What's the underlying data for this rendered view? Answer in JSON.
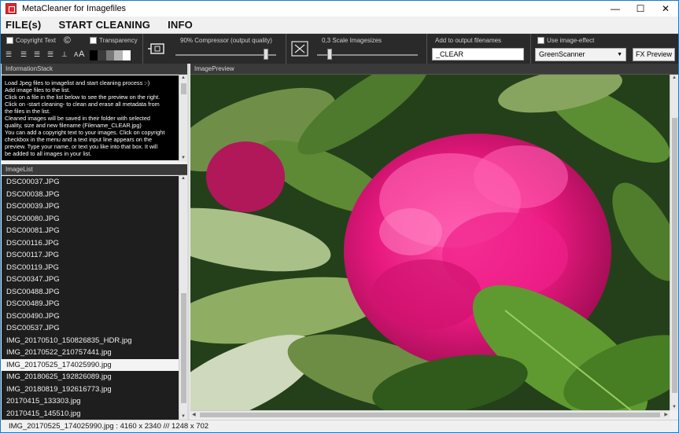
{
  "window": {
    "title": "MetaCleaner for Imagefiles",
    "controls": {
      "minimize": "—",
      "maximize": "☐",
      "close": "✕"
    }
  },
  "menu": [
    "FILE(s)",
    "START CLEANING",
    "INFO"
  ],
  "toolbar": {
    "copyright_label": "Copyright Text",
    "copyright_symbol": "©",
    "transparency_label": "Transparency",
    "compressor_label": "90% Compressor (output quality)",
    "compressor_value": 0.9,
    "scale_label": "0,3 Scale Imagesizes",
    "scale_value": 0.3,
    "filename_label": "Add to output filenames",
    "filename_value": "_CLEAR",
    "image_effect_label": "Use image-effect",
    "effect_selected": "GreenScanner",
    "fx_preview_label": "FX Preview",
    "font_size_icon": "A",
    "font_size_icon_small": "A"
  },
  "info_panel": {
    "header": "InformationStack",
    "lines": [
      "Load Jpeg files to imagelist and start cleaning process :-)",
      "Add image files to the list.",
      "Click on a file in the list below to see the preview on the right.",
      "Click on -start cleaning- to clean and erase all metadata from",
      "the files in the list.",
      "Cleaned images will be saved in their folder with selected",
      "quality, size and new filename (Filename_CLEAR.jpg)",
      "You can add a copyright text to your images. Click on copyright",
      "checkbox in the menu and a text input line appears on the",
      "preview. Type your name, or text you like into that box. It will",
      "be added to all images in your list."
    ]
  },
  "image_list": {
    "header": "ImageList",
    "items": [
      "DSC00037.JPG",
      "DSC00038.JPG",
      "DSC00039.JPG",
      "DSC00080.JPG",
      "DSC00081.JPG",
      "DSC00116.JPG",
      "DSC00117.JPG",
      "DSC00119.JPG",
      "DSC00347.JPG",
      "DSC00488.JPG",
      "DSC00489.JPG",
      "DSC00490.JPG",
      "DSC00537.JPG",
      "IMG_20170510_150826835_HDR.jpg",
      "IMG_20170522_210757441.jpg",
      "IMG_20170525_174025990.jpg",
      "IMG_20180625_192826089.jpg",
      "IMG_20180819_192616773.jpg",
      "20170415_133303.jpg",
      "20170415_145510.jpg"
    ],
    "selected_index": 15
  },
  "preview": {
    "header": "ImagePreview"
  },
  "status": "IMG_20170525_174025990.jpg : 4160 x 2340 /// 1248 x 702",
  "colors": {
    "toolbar_bg": "#2a2a2a",
    "list_bg": "#1e1e1e",
    "info_bg": "#000000",
    "flower_pink": "#e8197f",
    "leaf_green": "#3f6a22"
  }
}
